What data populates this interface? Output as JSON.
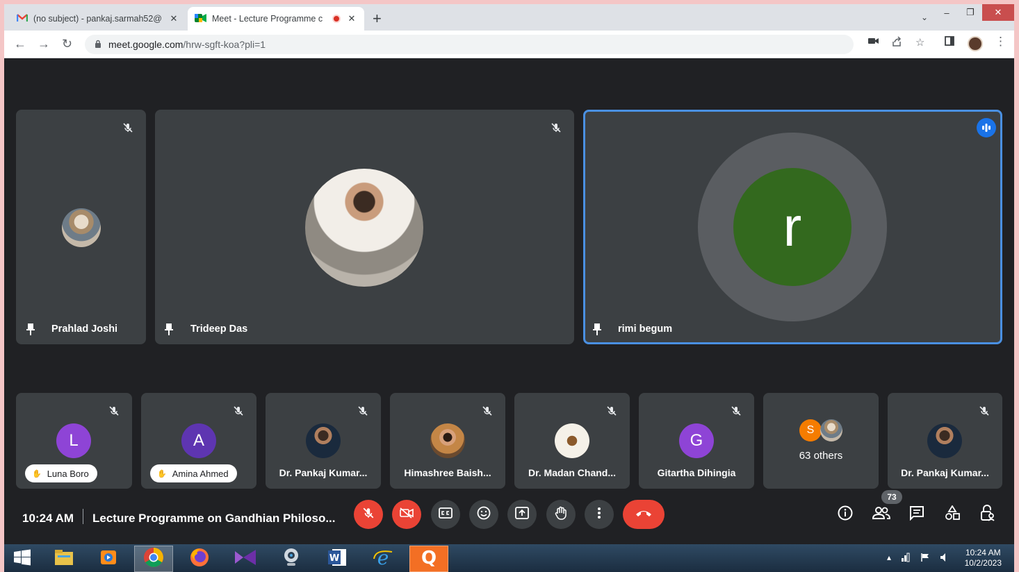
{
  "browser": {
    "tabs": [
      {
        "title": "(no subject) - pankaj.sarmah52@",
        "icon": "gmail-icon",
        "active": false
      },
      {
        "title": "Meet - Lecture Programme c",
        "icon": "meet-icon",
        "active": true
      }
    ],
    "new_tab_label": "+",
    "url_host": "meet.google.com",
    "url_path": "/hrw-sgft-koa?pli=1"
  },
  "meet": {
    "main_tiles": [
      {
        "name": "Prahlad Joshi",
        "muted": true
      },
      {
        "name": "Trideep Das",
        "muted": true
      },
      {
        "name": "rimi begum",
        "initial": "r",
        "speaking": true,
        "avatar_color": "#33691e"
      }
    ],
    "strip_tiles": [
      {
        "name": "Luna Boro",
        "initial": "L",
        "avatar_color": "#8e44d6",
        "hand_raised": true
      },
      {
        "name": "Amina Ahmed",
        "initial": "A",
        "avatar_color": "#5e35b1",
        "hand_raised": true
      },
      {
        "name": "Dr. Pankaj Kumar..."
      },
      {
        "name": "Himashree Baish..."
      },
      {
        "name": "Dr. Madan Chand..."
      },
      {
        "name": "Gitartha Dihingia",
        "initial": "G",
        "avatar_color": "#8e44d6"
      },
      {
        "name": "63 others",
        "others_initial": "S",
        "others_color": "#f57c00"
      },
      {
        "name": "Dr. Pankaj Kumar..."
      }
    ],
    "time": "10:24 AM",
    "meeting_title": "Lecture Programme on Gandhian Philoso...",
    "participant_count": "73",
    "accent_colors": {
      "speaking_border": "#4a90e2",
      "danger": "#ea4335"
    }
  },
  "taskbar": {
    "clock_time": "10:24 AM",
    "clock_date": "10/2/2023",
    "apps": [
      "windows-start",
      "file-explorer",
      "media-player",
      "chrome",
      "firefox",
      "visual-studio",
      "webcam",
      "word",
      "internet-explorer",
      "q-app"
    ]
  }
}
